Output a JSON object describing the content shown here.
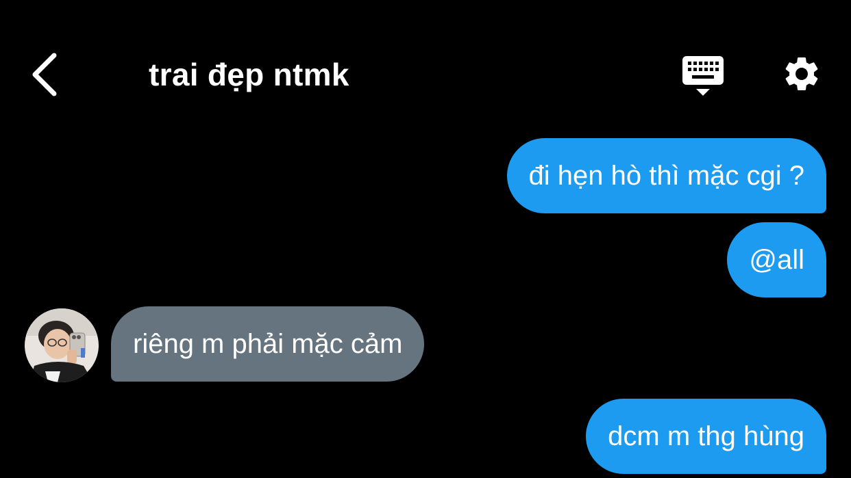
{
  "header": {
    "title": "trai đẹp ntmk",
    "back_icon": "chevron-left-icon",
    "keyboard_icon": "keyboard-icon",
    "settings_icon": "gear-icon"
  },
  "messages": [
    {
      "direction": "outgoing",
      "text": "đi hẹn hò thì mặc cgi ?"
    },
    {
      "direction": "outgoing",
      "text": "@all"
    },
    {
      "direction": "incoming",
      "text": "riêng m phải mặc cảm"
    },
    {
      "direction": "outgoing",
      "text": "dcm m thg hùng"
    }
  ],
  "colors": {
    "background": "#000000",
    "outgoing_bubble": "#1d9bf0",
    "incoming_bubble": "#66747f",
    "text": "#ffffff"
  }
}
